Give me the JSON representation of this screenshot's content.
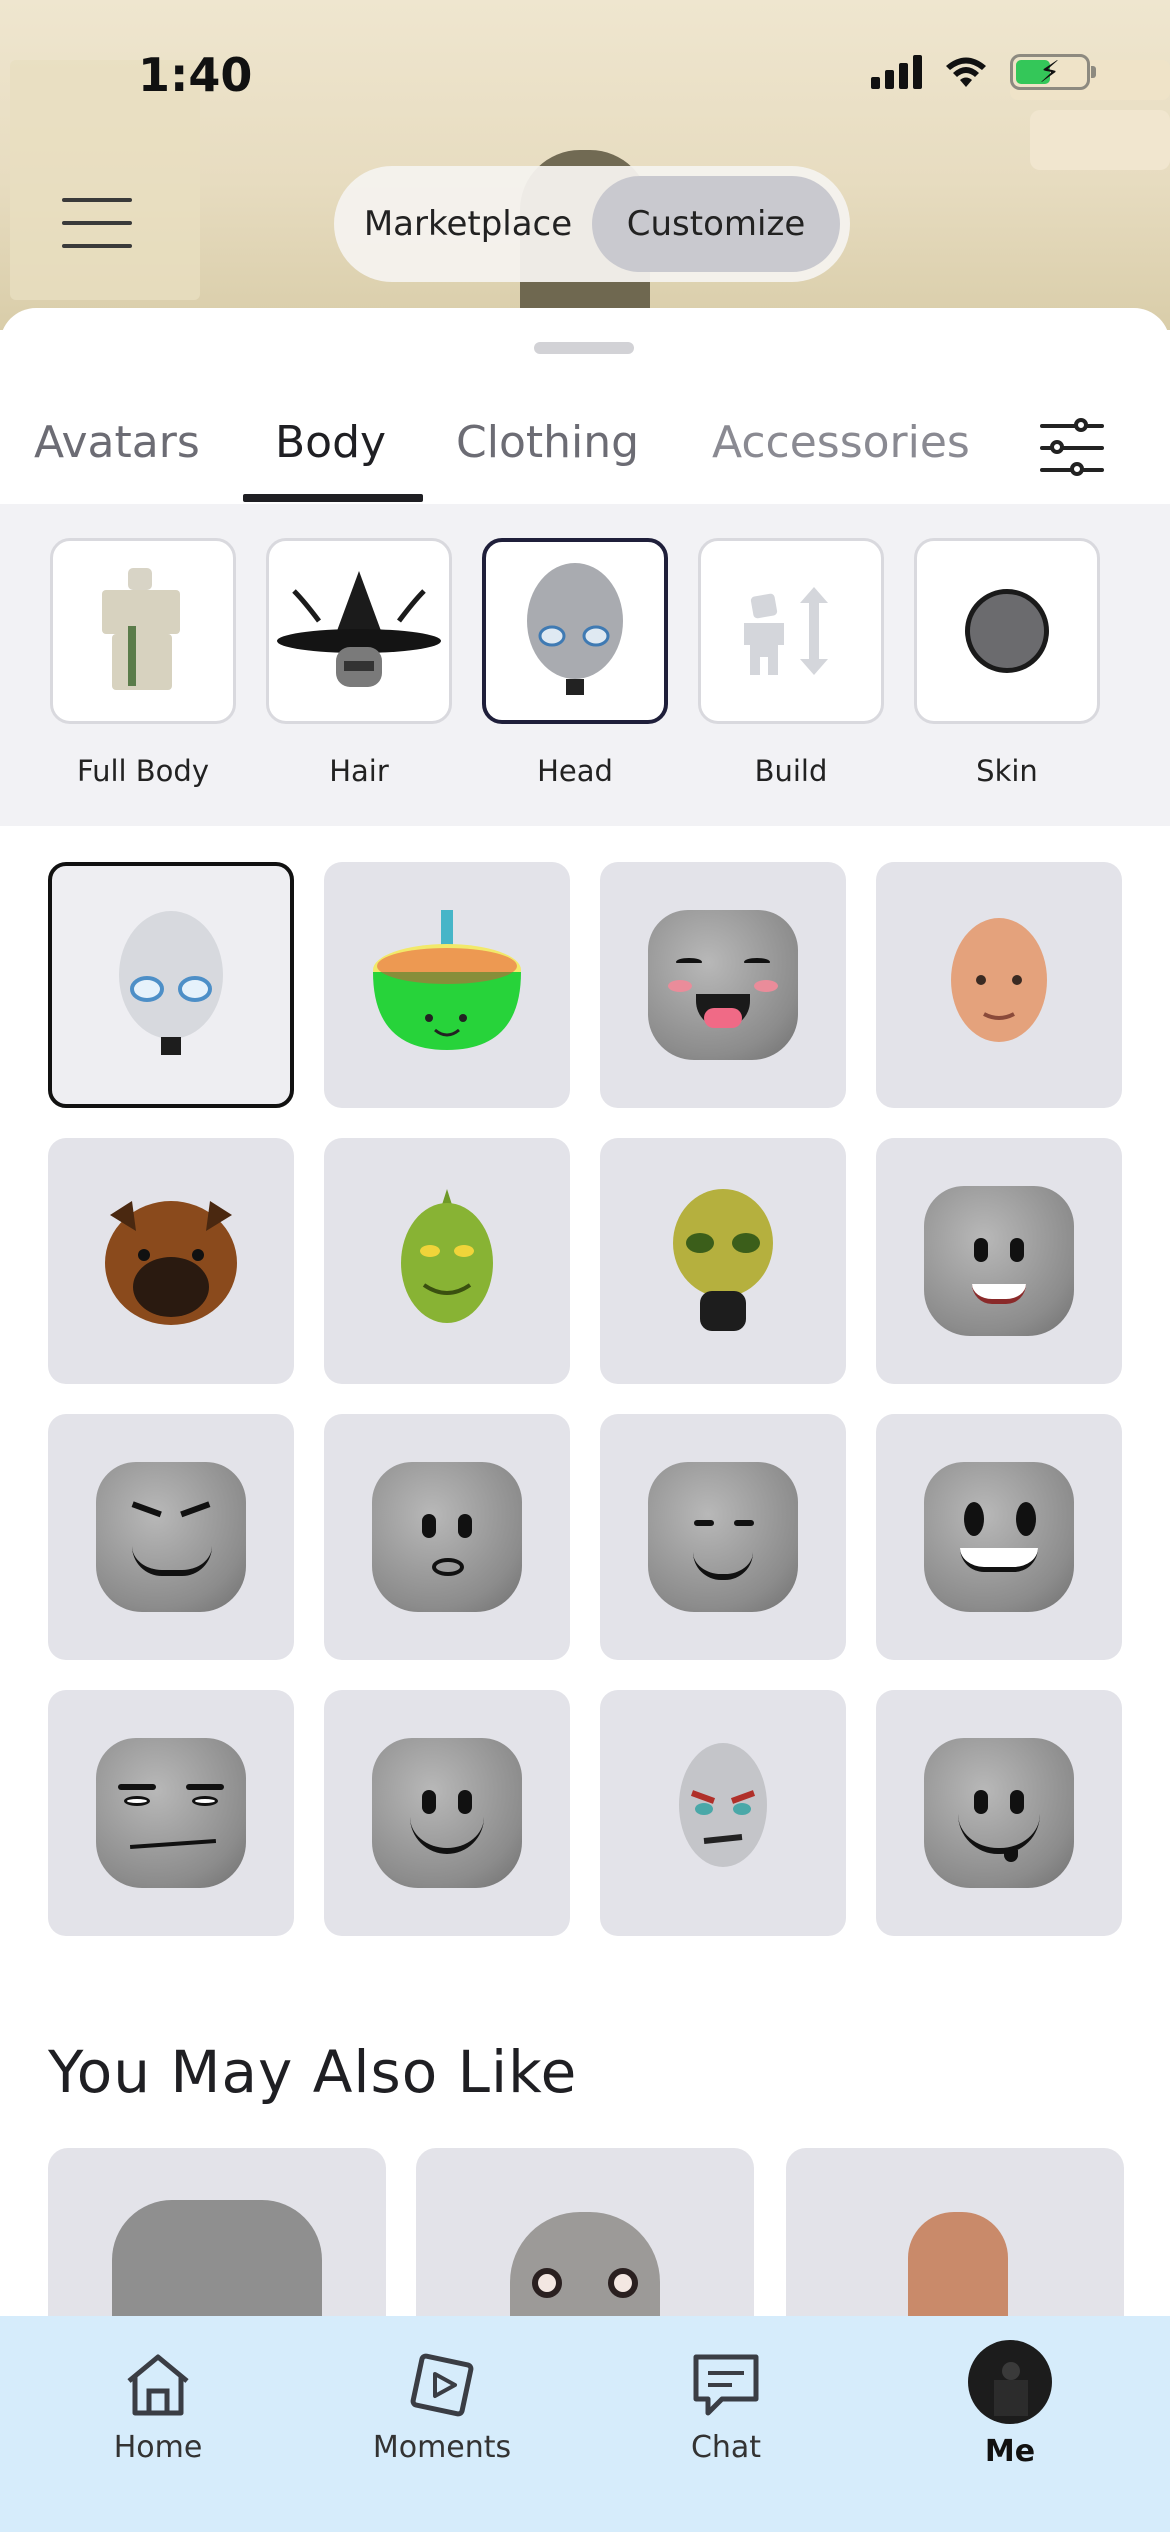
{
  "status_bar": {
    "time": "1:40"
  },
  "header": {
    "segments": [
      {
        "label": "Marketplace",
        "active": false
      },
      {
        "label": "Customize",
        "active": true
      }
    ]
  },
  "tabs": [
    {
      "label": "Avatars",
      "active": false
    },
    {
      "label": "Body",
      "active": true
    },
    {
      "label": "Clothing",
      "active": false
    },
    {
      "label": "Accessories",
      "active": false
    }
  ],
  "categories": [
    {
      "label": "Full Body",
      "icon": "full-body-thumbnail",
      "active": false
    },
    {
      "label": "Hair",
      "icon": "witch-hat-hair-thumbnail",
      "active": false
    },
    {
      "label": "Head",
      "icon": "head-thumbnail",
      "active": true
    },
    {
      "label": "Build",
      "icon": "build-icon",
      "active": false
    },
    {
      "label": "Skin",
      "icon": "skin-swatch-icon",
      "active": false
    }
  ],
  "items": [
    {
      "name": "silver-alien-head",
      "selected": true
    },
    {
      "name": "birthday-cake-head",
      "selected": false
    },
    {
      "name": "blushing-smile-head",
      "selected": false
    },
    {
      "name": "bald-man-head",
      "selected": false
    },
    {
      "name": "bulldog-head",
      "selected": false
    },
    {
      "name": "grinch-head",
      "selected": false
    },
    {
      "name": "gas-mask-alien-head",
      "selected": false
    },
    {
      "name": "happy-smile-head",
      "selected": false
    },
    {
      "name": "evil-grin-head",
      "selected": false
    },
    {
      "name": "surprised-head",
      "selected": false
    },
    {
      "name": "content-smile-head",
      "selected": false
    },
    {
      "name": "big-eyes-grin-head",
      "selected": false
    },
    {
      "name": "man-face-head",
      "selected": false
    },
    {
      "name": "classic-smile-head",
      "selected": false
    },
    {
      "name": "angry-villain-head",
      "selected": false
    },
    {
      "name": "tongue-smile-head",
      "selected": false
    }
  ],
  "recommendations": {
    "title": "You May Also Like",
    "items": [
      {
        "name": "recommended-head-1"
      },
      {
        "name": "recommended-head-2"
      },
      {
        "name": "recommended-head-3"
      }
    ]
  },
  "bottom_nav": [
    {
      "label": "Home",
      "icon": "home-icon",
      "active": false
    },
    {
      "label": "Moments",
      "icon": "moments-icon",
      "active": false
    },
    {
      "label": "Chat",
      "icon": "chat-icon",
      "active": false
    },
    {
      "label": "Me",
      "icon": "avatar-icon",
      "active": true
    }
  ],
  "colors": {
    "accent": "#1f1f23",
    "nav_background": "#d6ecfb",
    "tile_background": "#e3e3e9",
    "battery": "#34c759"
  }
}
